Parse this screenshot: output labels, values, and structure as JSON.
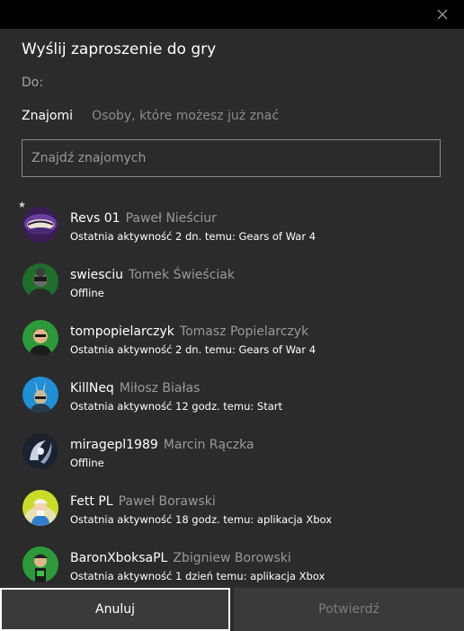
{
  "dialog": {
    "title": "Wyślij zaproszenie do gry",
    "to_label": "Do:",
    "close_icon": "close-icon"
  },
  "tabs": [
    {
      "label": "Znajomi",
      "active": true
    },
    {
      "label": "Osoby, które możesz już znać",
      "active": false
    }
  ],
  "search": {
    "placeholder": "Znajdź znajomych",
    "value": ""
  },
  "friends": [
    {
      "gamertag": "Revs 01",
      "real_name": "Paweł Nieściur",
      "status": "Ostatnia aktywność 2 dn. temu: Gears of War 4",
      "favorite": true
    },
    {
      "gamertag": "swiesciu",
      "real_name": "Tomek Świeściak",
      "status": "Offline",
      "favorite": false
    },
    {
      "gamertag": "tompopielarczyk",
      "real_name": "Tomasz Popielarczyk",
      "status": "Ostatnia aktywność 2 dn. temu: Gears of War 4",
      "favorite": false
    },
    {
      "gamertag": "KillNeq",
      "real_name": "Miłosz Białas",
      "status": "Ostatnia aktywność 12 godz. temu: Start",
      "favorite": false
    },
    {
      "gamertag": "miragepl1989",
      "real_name": "Marcin Rączka",
      "status": "Offline",
      "favorite": false
    },
    {
      "gamertag": "Fett PL",
      "real_name": "Paweł Borawski",
      "status": "Ostatnia aktywność 18 godz. temu: aplikacja Xbox",
      "favorite": false
    },
    {
      "gamertag": "BaronXboksaPL",
      "real_name": "Zbigniew Borowski",
      "status": "Ostatnia aktywność 1 dzień temu: aplikacja Xbox",
      "favorite": false
    }
  ],
  "buttons": {
    "cancel": "Anuluj",
    "confirm": "Potwierdź"
  },
  "colors": {
    "background": "#2b2b2b",
    "titlebar": "#000000",
    "button": "#3a3a3a"
  }
}
